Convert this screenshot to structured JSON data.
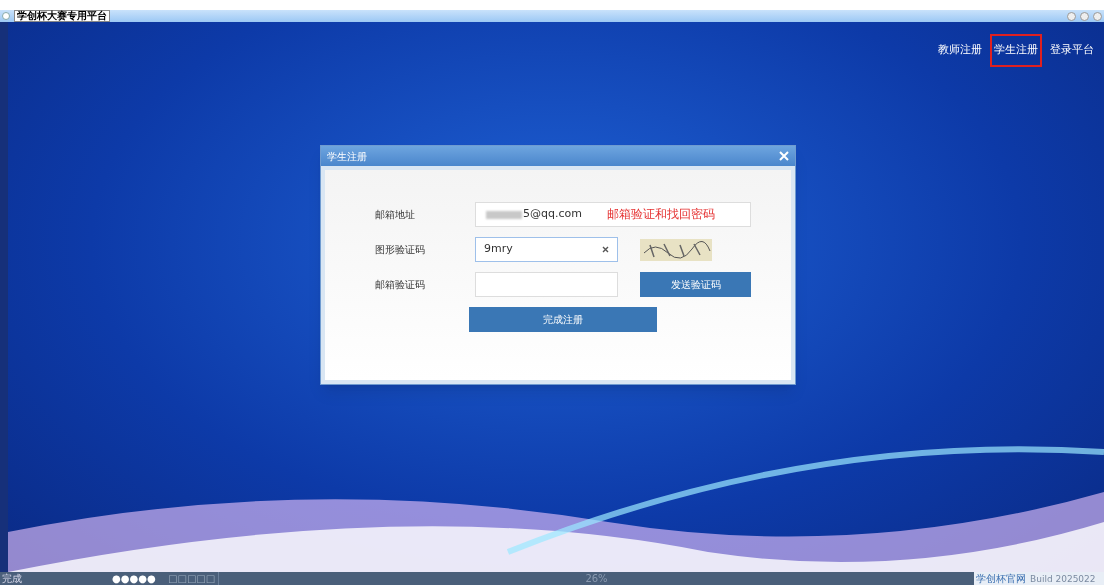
{
  "window": {
    "title": "学创杯大赛专用平台"
  },
  "top_links": [
    {
      "label": "教师注册",
      "selected": false
    },
    {
      "label": "学生注册",
      "selected": true
    },
    {
      "label": "登录平台",
      "selected": false
    }
  ],
  "dialog": {
    "title": "学生注册",
    "annotation": "邮箱验证和找回密码",
    "fields": [
      {
        "label": "邮箱地址",
        "value": "5@qq.com",
        "kind": "email"
      },
      {
        "label": "图形验证码",
        "value": "9mry",
        "kind": "captcha"
      },
      {
        "label": "邮箱验证码",
        "kind": "code",
        "button": "发送验证码"
      }
    ],
    "submit": "完成注册"
  },
  "status_bar": {
    "status": "完成",
    "dots": "●●●●●",
    "boxes": "□□□□□",
    "progress": "26%",
    "link": "学创杯官网",
    "build": "Build 2025022"
  }
}
